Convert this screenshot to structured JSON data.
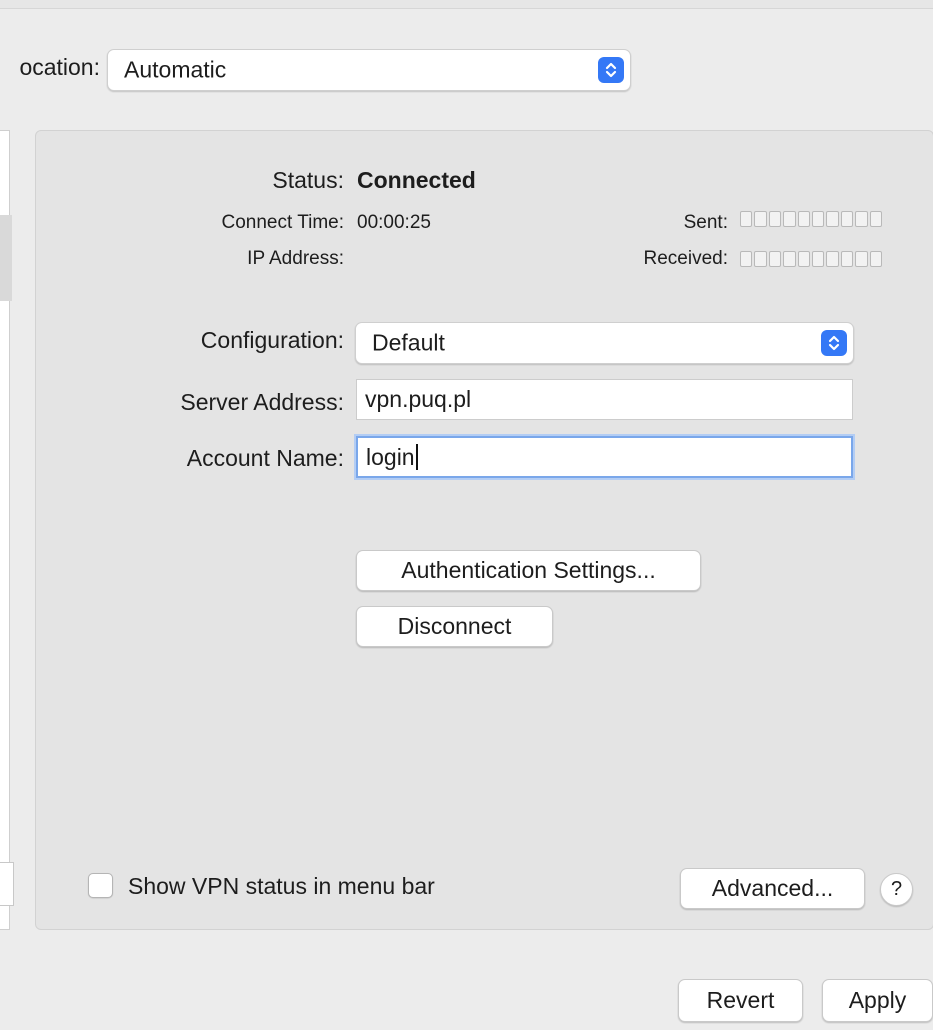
{
  "location": {
    "label": "ocation:",
    "selected": "Automatic"
  },
  "status": {
    "label": "Status:",
    "value": "Connected",
    "connect_time_label": "Connect Time:",
    "connect_time_value": "00:00:25",
    "ip_address_label": "IP Address:",
    "sent_label": "Sent:",
    "received_label": "Received:"
  },
  "form": {
    "configuration_label": "Configuration:",
    "configuration_value": "Default",
    "server_address_label": "Server Address:",
    "server_address_value": "vpn.puq.pl",
    "account_name_label": "Account Name:",
    "account_name_value": "login"
  },
  "buttons": {
    "authentication_settings": "Authentication Settings...",
    "disconnect": "Disconnect",
    "advanced": "Advanced...",
    "help": "?",
    "revert": "Revert",
    "apply": "Apply"
  },
  "options": {
    "show_vpn_status_label": "Show VPN status in menu bar",
    "show_vpn_status_checked": false
  },
  "colors": {
    "accent": "#3478f6",
    "focus_ring": "#7aa7ea"
  }
}
